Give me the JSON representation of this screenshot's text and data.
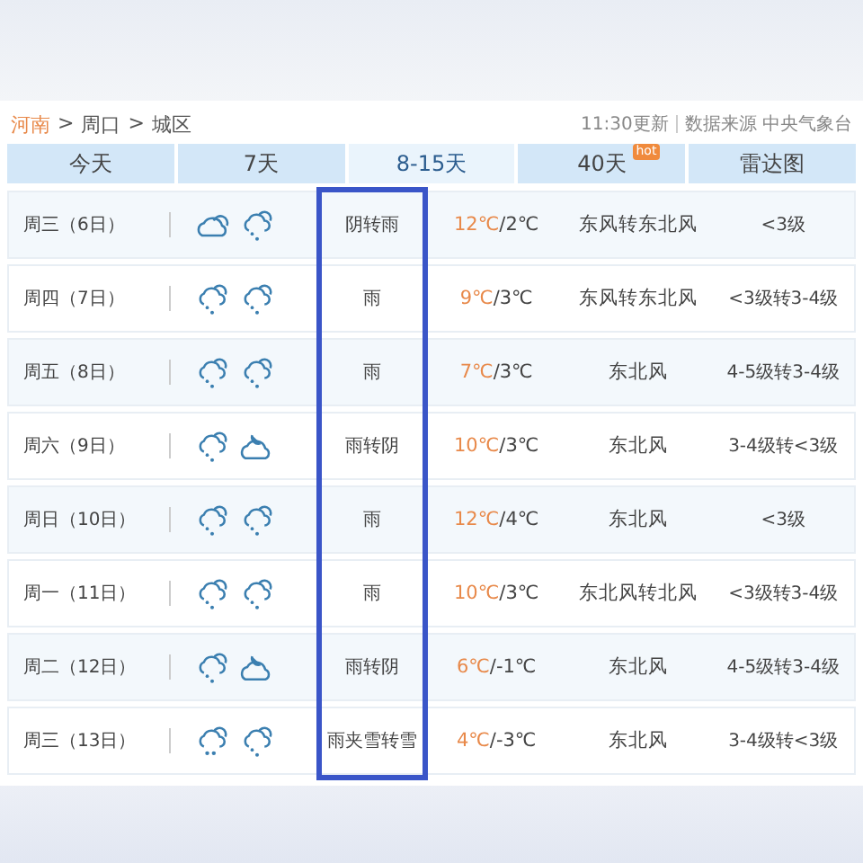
{
  "breadcrumb": [
    {
      "label": "河南",
      "link": true
    },
    {
      "label": ">",
      "link": false
    },
    {
      "label": "周口",
      "link": false
    },
    {
      "label": ">",
      "link": false
    },
    {
      "label": "城区",
      "link": false
    }
  ],
  "update": {
    "time": "11:30更新",
    "source": "数据来源 中央气象台"
  },
  "tabs": [
    {
      "label": "今天",
      "selected": false
    },
    {
      "label": "7天",
      "selected": false
    },
    {
      "label": "8-15天",
      "selected": true
    },
    {
      "label": "40天",
      "selected": false,
      "badge": "hot"
    },
    {
      "label": "雷达图",
      "selected": false
    }
  ],
  "weather_column_highlighted": true,
  "rows": [
    {
      "day": "周三（6日）",
      "icons": [
        {
          "kind": "cloudy"
        },
        {
          "kind": "rain"
        }
      ],
      "weather": "阴转雨",
      "high": "12℃",
      "low": "/2℃",
      "wind": "东风转东北风",
      "level": "<3级"
    },
    {
      "day": "周四（7日）",
      "icons": [
        {
          "kind": "rain"
        },
        {
          "kind": "rain"
        }
      ],
      "weather": "雨",
      "high": "9℃",
      "low": "/3℃",
      "wind": "东风转东北风",
      "level": "<3级转3-4级"
    },
    {
      "day": "周五（8日）",
      "icons": [
        {
          "kind": "rain"
        },
        {
          "kind": "rain"
        }
      ],
      "weather": "雨",
      "high": "7℃",
      "low": "/3℃",
      "wind": "东北风",
      "level": "4-5级转3-4级"
    },
    {
      "day": "周六（9日）",
      "icons": [
        {
          "kind": "rain"
        },
        {
          "kind": "cloudy-night"
        }
      ],
      "weather": "雨转阴",
      "high": "10℃",
      "low": "/3℃",
      "wind": "东北风",
      "level": "3-4级转<3级"
    },
    {
      "day": "周日（10日）",
      "icons": [
        {
          "kind": "rain"
        },
        {
          "kind": "rain"
        }
      ],
      "weather": "雨",
      "high": "12℃",
      "low": "/4℃",
      "wind": "东北风",
      "level": "<3级"
    },
    {
      "day": "周一（11日）",
      "icons": [
        {
          "kind": "rain"
        },
        {
          "kind": "rain"
        }
      ],
      "weather": "雨",
      "high": "10℃",
      "low": "/3℃",
      "wind": "东北风转北风",
      "level": "<3级转3-4级"
    },
    {
      "day": "周二（12日）",
      "icons": [
        {
          "kind": "rain"
        },
        {
          "kind": "cloudy-night"
        }
      ],
      "weather": "雨转阴",
      "high": "6℃",
      "low": "/-1℃",
      "wind": "东北风",
      "level": "4-5级转3-4级"
    },
    {
      "day": "周三（13日）",
      "icons": [
        {
          "kind": "sleet"
        },
        {
          "kind": "rain"
        }
      ],
      "weather": "雨夹雪转雪",
      "high": "4℃",
      "low": "/-3℃",
      "wind": "东北风",
      "level": "3-4级转<3级"
    }
  ]
}
